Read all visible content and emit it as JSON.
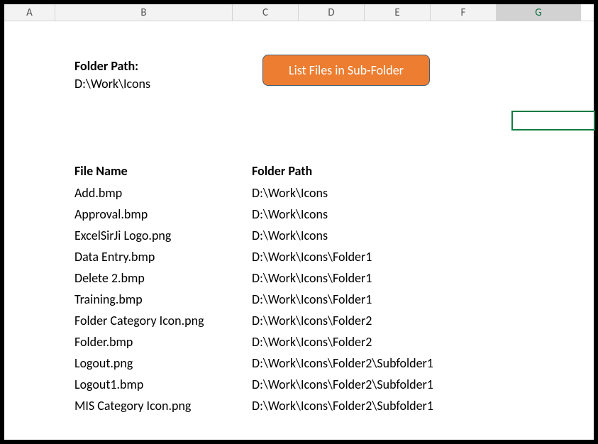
{
  "columns": [
    "A",
    "B",
    "C",
    "D",
    "E",
    "F",
    "G"
  ],
  "activeColumn": "G",
  "folderPath": {
    "label": "Folder Path:",
    "value": "D:\\Work\\Icons"
  },
  "button": {
    "label": "List Files in Sub-Folder"
  },
  "table": {
    "headers": {
      "file": "File Name",
      "folder": "Folder Path"
    },
    "rows": [
      {
        "file": "Add.bmp",
        "folder": "D:\\Work\\Icons"
      },
      {
        "file": "Approval.bmp",
        "folder": "D:\\Work\\Icons"
      },
      {
        "file": "ExcelSirJi Logo.png",
        "folder": "D:\\Work\\Icons"
      },
      {
        "file": "Data Entry.bmp",
        "folder": "D:\\Work\\Icons\\Folder1"
      },
      {
        "file": "Delete 2.bmp",
        "folder": "D:\\Work\\Icons\\Folder1"
      },
      {
        "file": "Training.bmp",
        "folder": "D:\\Work\\Icons\\Folder1"
      },
      {
        "file": "Folder Category Icon.png",
        "folder": "D:\\Work\\Icons\\Folder2"
      },
      {
        "file": "Folder.bmp",
        "folder": "D:\\Work\\Icons\\Folder2"
      },
      {
        "file": "Logout.png",
        "folder": "D:\\Work\\Icons\\Folder2\\Subfolder1"
      },
      {
        "file": "Logout1.bmp",
        "folder": "D:\\Work\\Icons\\Folder2\\Subfolder1"
      },
      {
        "file": "MIS Category Icon.png",
        "folder": "D:\\Work\\Icons\\Folder2\\Subfolder1"
      }
    ]
  }
}
